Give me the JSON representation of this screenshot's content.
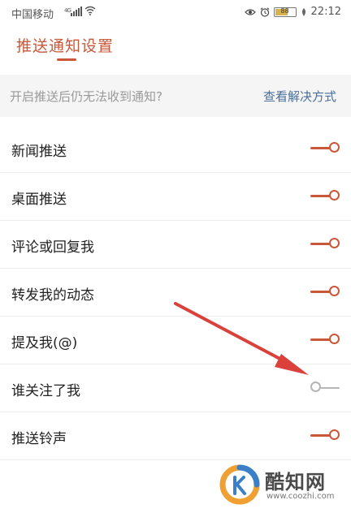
{
  "status_bar": {
    "carrier": "中国移动",
    "signal_tag": "4G",
    "battery": "88",
    "time": "22:12"
  },
  "header": {
    "title": "推送通知设置"
  },
  "notice": {
    "text": "开启推送后仍无法收到通知?",
    "link": "查看解决方式"
  },
  "settings": [
    {
      "label": "新闻推送",
      "on": true
    },
    {
      "label": "桌面推送",
      "on": true
    },
    {
      "label": "评论或回复我",
      "on": true
    },
    {
      "label": "转发我的动态",
      "on": true
    },
    {
      "label": "提及我(@)",
      "on": true
    },
    {
      "label": "谁关注了我",
      "on": false
    },
    {
      "label": "推送铃声",
      "on": true
    }
  ],
  "watermark": {
    "name": "酷知网",
    "url": "www.coozhi.com"
  },
  "colors": {
    "accent": "#c9583a",
    "link": "#4a6f9c",
    "annotation": "#d9413a"
  }
}
